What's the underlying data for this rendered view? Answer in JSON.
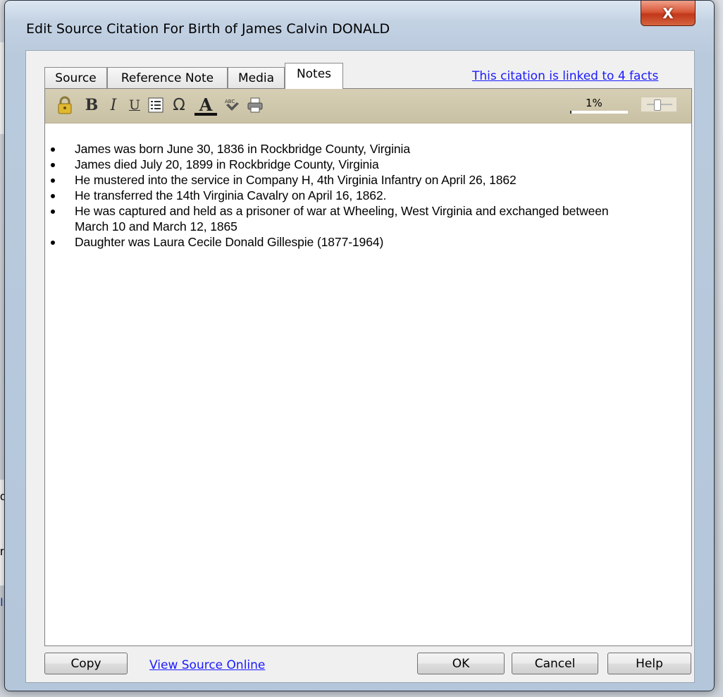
{
  "dialog": {
    "title": "Edit Source Citation For Birth of James Calvin DONALD",
    "close_glyph": "X"
  },
  "tabs": [
    {
      "label": "Source",
      "active": false
    },
    {
      "label": "Reference Note",
      "active": false
    },
    {
      "label": "Media",
      "active": false
    },
    {
      "label": "Notes",
      "active": true
    }
  ],
  "linked_facts_link": "This citation is linked to 4 facts",
  "toolbar": {
    "icons": [
      "lock-icon",
      "bold-icon",
      "italic-icon",
      "underline-icon",
      "bullet-list-icon",
      "special-character-icon",
      "font-color-icon",
      "spell-check-icon",
      "print-icon"
    ],
    "bold_glyph": "B",
    "italic_glyph": "I",
    "underline_glyph": "U",
    "omega_glyph": "Ω",
    "font_color_glyph": "A",
    "zoom_level": "1%"
  },
  "notes": [
    "James was born June 30, 1836 in Rockbridge County, Virginia",
    "James died July 20, 1899 in Rockbridge County, Virginia",
    "He mustered into the service in Company H, 4th Virginia Infantry on April 26, 1862",
    "He transferred the 14th Virginia Cavalry on April 16, 1862.",
    "He was captured and held as a prisoner of war at Wheeling, West Virginia and exchanged between March 10 and March 12, 1865",
    "Daughter was Laura Cecile Donald Gillespie (1877-1964)"
  ],
  "buttons": {
    "copy": "Copy",
    "view_online": "View Source Online",
    "ok": "OK",
    "cancel": "Cancel",
    "help": "Help"
  },
  "background": {
    "fragments": [
      "om",
      "rs.",
      "In"
    ]
  },
  "colors": {
    "link": "#1a1aff",
    "toolbar": "#d6cfb5",
    "close_button": "#c2371a"
  }
}
